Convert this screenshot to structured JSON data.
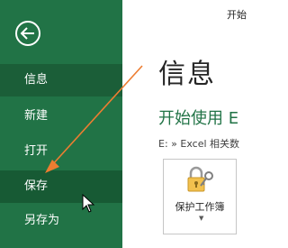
{
  "window": {
    "title": "开始"
  },
  "sidebar": {
    "back_icon": "back-arrow-icon",
    "items": [
      {
        "label": "信息"
      },
      {
        "label": "新建"
      },
      {
        "label": "打开"
      },
      {
        "label": "保存"
      },
      {
        "label": "另存为"
      }
    ],
    "active_item": "信息",
    "hovered_item": "保存"
  },
  "main": {
    "title": "信息",
    "section_title": "开始使用 E",
    "path": "E: » Excel 相关数",
    "protect_button": {
      "label": "保护工作簿",
      "icon": "lock-key-icon"
    }
  },
  "annotations": {
    "arrow_color": "#ed7d31",
    "cursor_icon": "mouse-pointer-icon"
  },
  "colors": {
    "sidebar_bg": "#217346",
    "active_bg": "#1b5e38",
    "accent_green": "#217346"
  }
}
